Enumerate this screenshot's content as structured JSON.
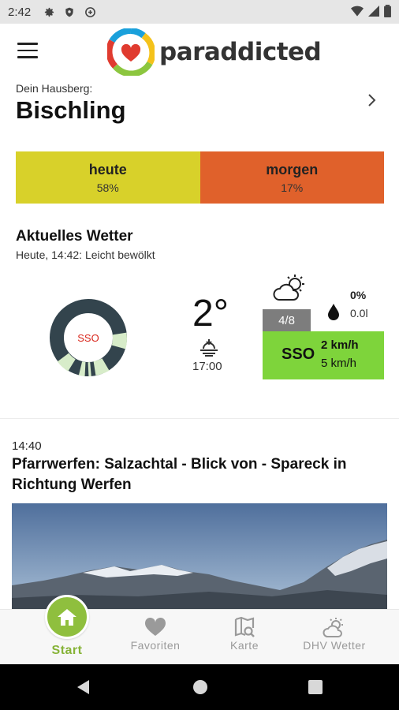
{
  "status_bar": {
    "time": "2:42"
  },
  "app": {
    "brand": "paraddicted",
    "menu_icon": "hamburger-menu-icon"
  },
  "hausberg": {
    "label": "Dein Hausberg:",
    "name": "Bischling"
  },
  "forecast": {
    "today": {
      "label": "heute",
      "percent": "58%",
      "color": "#d8d12a"
    },
    "tomorrow": {
      "label": "morgen",
      "percent": "17%",
      "color": "#e0612b"
    }
  },
  "weather": {
    "title": "Aktuelles Wetter",
    "subtitle": "Heute, 14:42: Leicht bewölkt",
    "wind_rose_label": "SSO",
    "temperature": "2°",
    "sun_time": "17:00",
    "cloud_cover": "4/8",
    "precip_percent": "0%",
    "precip_amount": "0.0l",
    "wind_direction": "SSO",
    "wind_speed": "2 km/h",
    "wind_gust": "5 km/h",
    "wind_color": "#7ed43b"
  },
  "webcam": {
    "time": "14:40",
    "title": "Pfarrwerfen: Salzachtal - Blick von - Spareck in Richtung Werfen"
  },
  "bottom_nav": {
    "items": [
      {
        "label": "Start",
        "icon": "home-icon",
        "active": true
      },
      {
        "label": "Favoriten",
        "icon": "heart-icon",
        "active": false
      },
      {
        "label": "Karte",
        "icon": "map-search-icon",
        "active": false
      },
      {
        "label": "DHV Wetter",
        "icon": "weather-icon",
        "active": false
      }
    ],
    "accent": "#86b337"
  }
}
